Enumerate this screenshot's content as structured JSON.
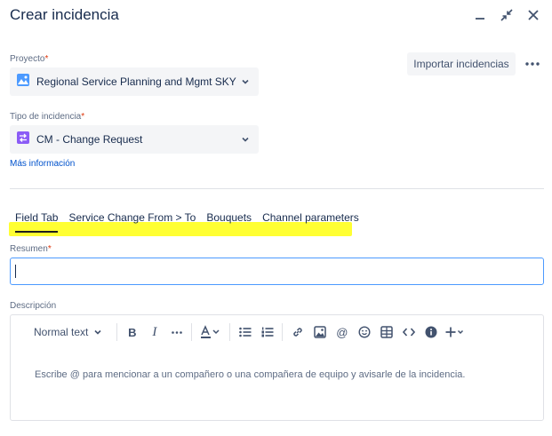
{
  "dialog": {
    "title": "Crear incidencia",
    "import_label": "Importar incidencias"
  },
  "project": {
    "label": "Proyecto",
    "required_mark": "*",
    "value": "Regional Service Planning and Mgmt SKY (SK"
  },
  "issue_type": {
    "label": "Tipo de incidencia",
    "required_mark": "*",
    "value": "CM - Change Request",
    "more_info_label": "Más información"
  },
  "tabs": [
    {
      "label": "Field Tab",
      "active": true
    },
    {
      "label": "Service Change From > To",
      "active": false
    },
    {
      "label": "Bouquets",
      "active": false
    },
    {
      "label": "Channel parameters",
      "active": false
    }
  ],
  "summary": {
    "label": "Resumen",
    "required_mark": "*",
    "value": ""
  },
  "description": {
    "label": "Descripción",
    "text_style": "Normal text",
    "placeholder": "Escribe @ para mencionar a un compañero o una compañera de equipo y avisarle de la incidencia."
  },
  "colors": {
    "accent": "#0052cc",
    "highlight": "#ffff33",
    "required": "#de350b",
    "focus_border": "#4c9aff"
  }
}
